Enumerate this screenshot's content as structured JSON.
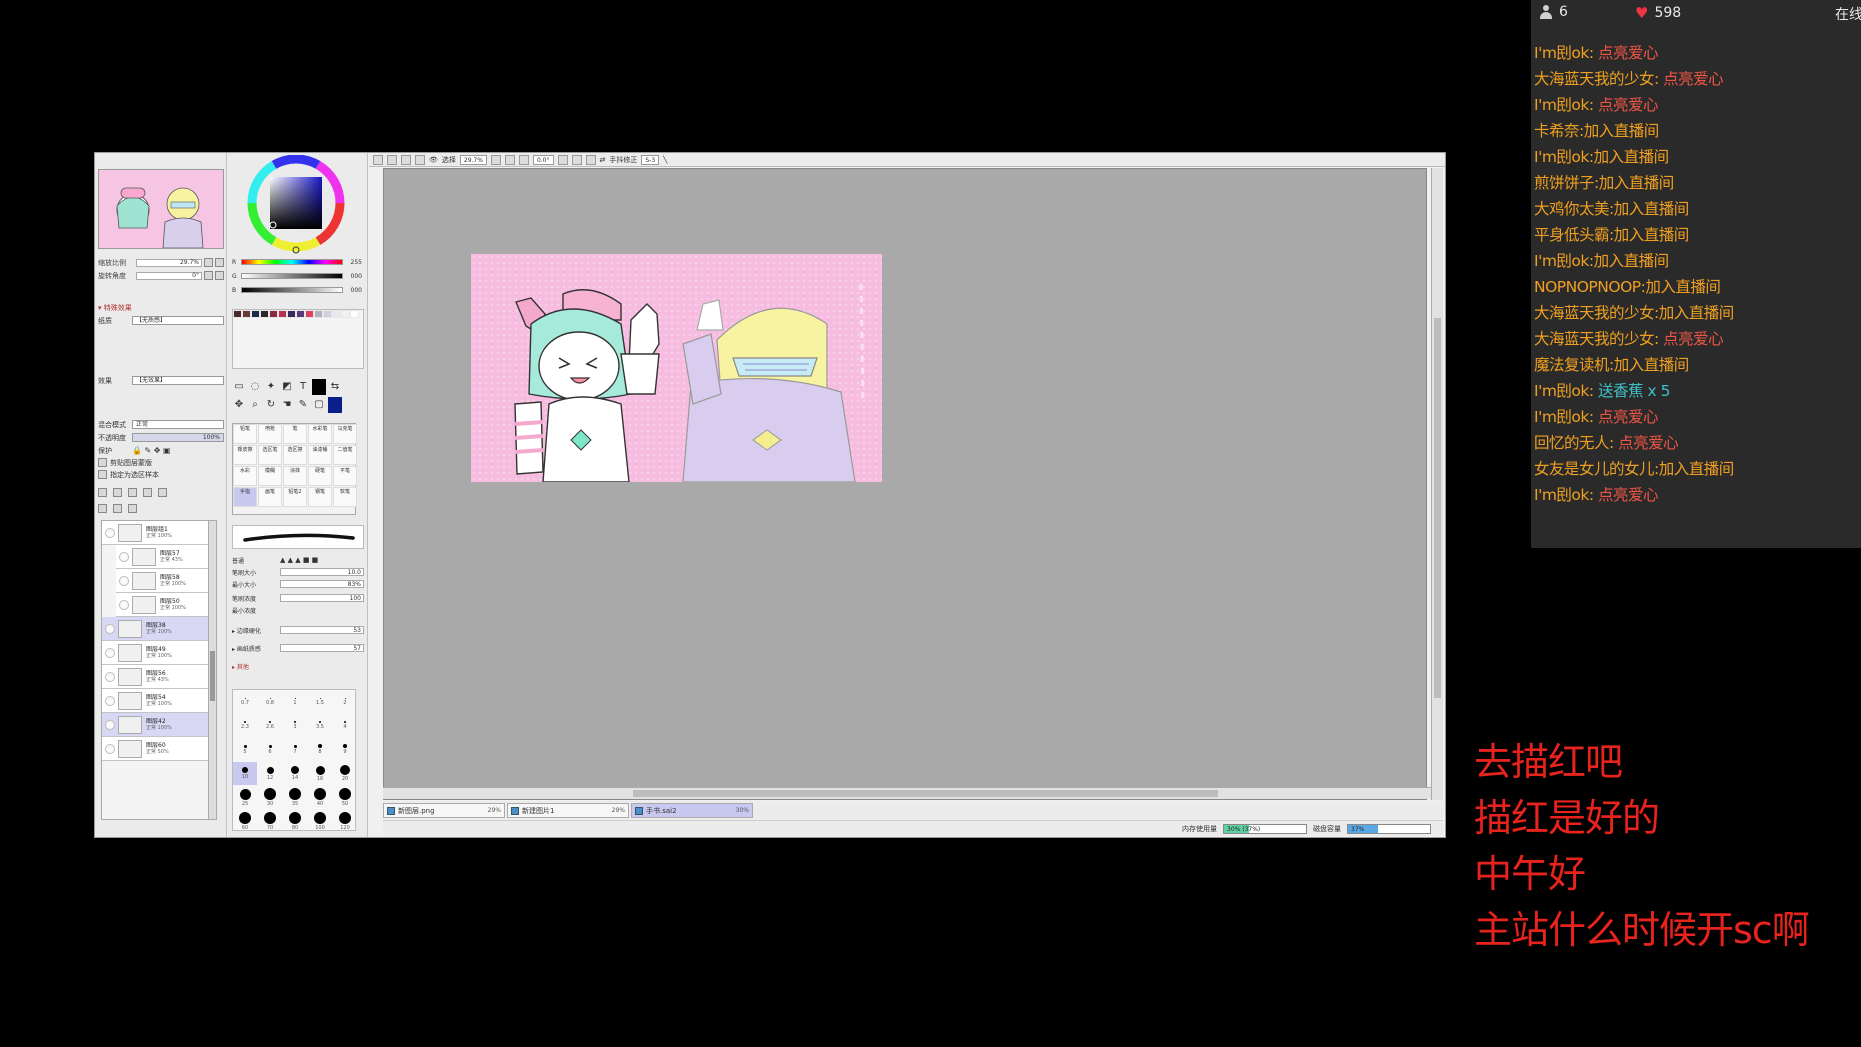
{
  "sai": {
    "navigator": {
      "zoom_label": "缩放比例",
      "zoom_value": "29.7%",
      "angle_label": "旋转角度",
      "angle_value": "0°"
    },
    "properties": {
      "section": "▾ 特殊效果",
      "paper_label": "纸质",
      "paper_value": "【无质感】",
      "effect_label": "效果",
      "effect_value": "【无效果】",
      "blend_label": "混合模式",
      "blend_value": "正常",
      "opacity_label": "不透明度",
      "opacity_value": "100%",
      "lock_label": "保护",
      "clip_label": "剪贴图层蒙版",
      "select_src_label": "指定为选区样本"
    },
    "layers": [
      {
        "name": "图层组1",
        "mode": "正常 100%",
        "sel": false,
        "child": false
      },
      {
        "name": "图层57",
        "mode": "正常 43%",
        "sel": false,
        "child": true
      },
      {
        "name": "图层58",
        "mode": "正常 100%",
        "sel": false,
        "child": true
      },
      {
        "name": "图层50",
        "mode": "正常 100%",
        "sel": false,
        "child": true
      },
      {
        "name": "图层38",
        "mode": "正常 100%",
        "sel": true,
        "child": false
      },
      {
        "name": "图层49",
        "mode": "正常 100%",
        "sel": false,
        "child": false
      },
      {
        "name": "图层56",
        "mode": "正常 43%",
        "sel": false,
        "child": false
      },
      {
        "name": "图层54",
        "mode": "正常 100%",
        "sel": false,
        "child": false
      },
      {
        "name": "图层42",
        "mode": "正常 100%",
        "sel": true,
        "child": false
      },
      {
        "name": "图层60",
        "mode": "正常 50%",
        "sel": false,
        "child": false
      }
    ],
    "color": {
      "r": {
        "ch": "R",
        "value": "255"
      },
      "g": {
        "ch": "G",
        "value": "000"
      },
      "b": {
        "ch": "B",
        "value": "000"
      }
    },
    "swatches": [
      "#4a2a2a",
      "#6a3a3a",
      "#1e2a4a",
      "#2a2a2a",
      "#8a2a3a",
      "#c03050",
      "#3a2a5a",
      "#5a3a7a",
      "#e04060",
      "#b0b0c0",
      "#d0d0e0",
      "#e8e8f0",
      "#f0f0f0",
      "#ffffff"
    ],
    "brushes": [
      {
        "label": "铅笔"
      },
      {
        "label": "喷枪"
      },
      {
        "label": "笔"
      },
      {
        "label": "水彩笔"
      },
      {
        "label": "马克笔"
      },
      {
        "label": "橡皮擦"
      },
      {
        "label": "选区笔"
      },
      {
        "label": "选区擦"
      },
      {
        "label": "油漆桶"
      },
      {
        "label": "二值笔"
      },
      {
        "label": "水彩"
      },
      {
        "label": "模糊"
      },
      {
        "label": "涂抹"
      },
      {
        "label": "硬笔"
      },
      {
        "label": "平笔"
      },
      {
        "label": "手指"
      },
      {
        "label": "画笔"
      },
      {
        "label": "铅笔2"
      },
      {
        "label": "钢笔"
      },
      {
        "label": "软笔"
      }
    ],
    "brush_params": {
      "shape_label": "普通",
      "size_label": "笔刷大小",
      "size_value": "10.0",
      "min_size_label": "最小大小",
      "min_size_value": "83%",
      "density_label": "笔刷浓度",
      "density_value": "100",
      "min_density_label": "最小浓度",
      "mix_label": "▸ 边缘硬化",
      "mix_value": "53",
      "texture_label": "▸ 画纸质感",
      "texture_value": "57",
      "extra_label": "▸ 其他"
    },
    "brush_sizes": [
      {
        "label": "0.7",
        "d": 1
      },
      {
        "label": "0.8",
        "d": 1
      },
      {
        "label": "1",
        "d": 1
      },
      {
        "label": "1.5",
        "d": 1
      },
      {
        "label": "2",
        "d": 1
      },
      {
        "label": "2.3",
        "d": 2
      },
      {
        "label": "2.6",
        "d": 2
      },
      {
        "label": "3",
        "d": 2
      },
      {
        "label": "3.5",
        "d": 2
      },
      {
        "label": "4",
        "d": 2
      },
      {
        "label": "5",
        "d": 3
      },
      {
        "label": "6",
        "d": 3
      },
      {
        "label": "7",
        "d": 3
      },
      {
        "label": "8",
        "d": 4
      },
      {
        "label": "9",
        "d": 4
      },
      {
        "label": "10",
        "d": 6
      },
      {
        "label": "12",
        "d": 7
      },
      {
        "label": "14",
        "d": 8
      },
      {
        "label": "16",
        "d": 9
      },
      {
        "label": "20",
        "d": 10
      },
      {
        "label": "25",
        "d": 11
      },
      {
        "label": "30",
        "d": 12
      },
      {
        "label": "35",
        "d": 12
      },
      {
        "label": "40",
        "d": 12
      },
      {
        "label": "50",
        "d": 12
      },
      {
        "label": "60",
        "d": 12
      },
      {
        "label": "70",
        "d": 12
      },
      {
        "label": "80",
        "d": 12
      },
      {
        "label": "100",
        "d": 12
      },
      {
        "label": "120",
        "d": 12
      }
    ],
    "toolbar": {
      "view_label": "选择",
      "zoom_value": "29.7%",
      "angle_value": "0.0°",
      "stabilizer_label": "手抖修正",
      "stabilizer_value": "S-3"
    },
    "doc_tabs": [
      {
        "name": "新图层.png",
        "pct": "29%",
        "active": false
      },
      {
        "name": "新建图片1",
        "pct": "29%",
        "active": false
      },
      {
        "name": "手书.sai2",
        "pct": "30%",
        "active": true
      }
    ],
    "status": {
      "memory_label": "内存使用量",
      "memory_value": "30% (37%)",
      "memory_fraction": 0.3,
      "disk_label": "磁盘容量",
      "disk_value": "37%",
      "disk_fraction": 0.37
    },
    "accent": "#c8c8f0"
  },
  "chat": {
    "viewers": "6",
    "likes": "598",
    "online_label": "在线",
    "messages": [
      {
        "user": "I'm刡ok:",
        "text": " 点亮爱心",
        "type": "like"
      },
      {
        "user": "大海蓝天我的少女:",
        "text": " 点亮爱心",
        "type": "like"
      },
      {
        "user": "I'm刡ok:",
        "text": " 点亮爱心",
        "type": "like"
      },
      {
        "user": "卡希奈:",
        "text": "加入直播间",
        "type": "join"
      },
      {
        "user": "I'm刡ok:",
        "text": "加入直播间",
        "type": "join"
      },
      {
        "user": "煎饼饼子:",
        "text": "加入直播间",
        "type": "join"
      },
      {
        "user": "大鸡你太美:",
        "text": "加入直播间",
        "type": "join"
      },
      {
        "user": "平身低头霸:",
        "text": "加入直播间",
        "type": "join"
      },
      {
        "user": "I'm刡ok:",
        "text": "加入直播间",
        "type": "join"
      },
      {
        "user": "NOPNOPNOOP:",
        "text": "加入直播间",
        "type": "join"
      },
      {
        "user": "大海蓝天我的少女:",
        "text": "加入直播间",
        "type": "join"
      },
      {
        "user": "大海蓝天我的少女:",
        "text": " 点亮爱心",
        "type": "like"
      },
      {
        "user": "魔法复读机:",
        "text": "加入直播间",
        "type": "join"
      },
      {
        "user": "I'm刡ok:",
        "text": " 送香蕉 x 5",
        "type": "gift"
      },
      {
        "user": "I'm刡ok:",
        "text": " 点亮爱心",
        "type": "like"
      },
      {
        "user": "回忆的无人:",
        "text": " 点亮爱心",
        "type": "like"
      },
      {
        "user": "女友是女儿的女儿:",
        "text": "加入直播间",
        "type": "join"
      },
      {
        "user": "I'm刡ok:",
        "text": " 点亮爱心",
        "type": "like"
      }
    ]
  },
  "overlay": {
    "lines": [
      "去描红吧",
      "描红是好的",
      "中午好",
      "主站什么时候开sc啊"
    ],
    "color": "#e8221d"
  }
}
